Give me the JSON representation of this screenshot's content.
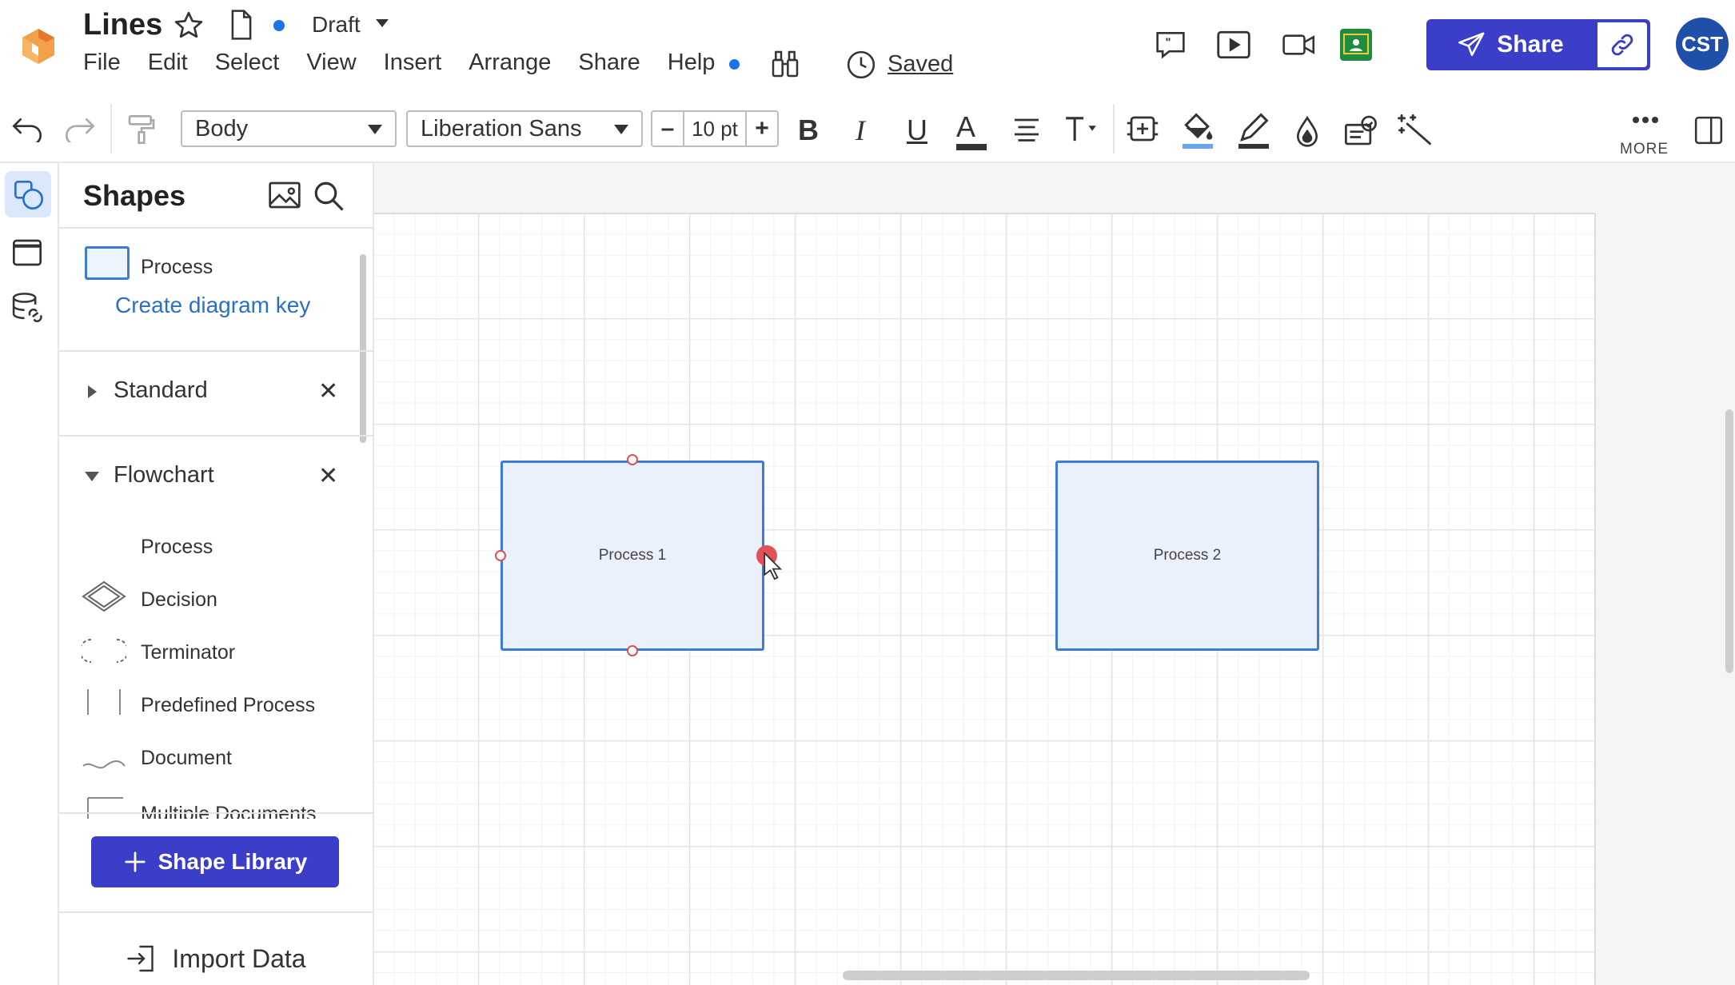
{
  "header": {
    "title": "Lines",
    "status": "Draft",
    "saved_label": "Saved",
    "menu": [
      "File",
      "Edit",
      "Select",
      "View",
      "Insert",
      "Arrange",
      "Share",
      "Help"
    ],
    "share_label": "Share",
    "avatar_initials": "CST"
  },
  "toolbar": {
    "style_value": "Body",
    "font_value": "Liberation Sans",
    "font_size": "10 pt",
    "decrease_label": "–",
    "increase_label": "+",
    "bold": "B",
    "italic": "I",
    "underline": "U",
    "text_color": "A",
    "more_label": "MORE"
  },
  "panel": {
    "title": "Shapes",
    "key_item_label": "Process",
    "create_key_link": "Create diagram key",
    "sections": [
      {
        "label": "Standard",
        "expanded": false
      },
      {
        "label": "Flowchart",
        "expanded": true
      }
    ],
    "flowchart_shapes": [
      "Process",
      "Decision",
      "Terminator",
      "Predefined Process",
      "Document",
      "Multiple Documents"
    ],
    "shape_library_button": "Shape Library",
    "import_data_button": "Import Data"
  },
  "canvas": {
    "shapes": [
      {
        "label": "Process 1",
        "selected_connection_point": "right"
      },
      {
        "label": "Process 2"
      }
    ]
  },
  "colors": {
    "accent": "#3b3ec9",
    "link": "#2a6fc9",
    "shape_border": "#3d7bd9",
    "shape_fill": "#eaf1fc",
    "handle": "#e05257",
    "avatar": "#1f4fa8"
  },
  "icons": [
    "logo-icon",
    "star-icon",
    "document-icon",
    "binoculars-icon",
    "clock-icon",
    "comment-icon",
    "present-icon",
    "video-icon",
    "classroom-icon",
    "send-icon",
    "link-icon",
    "undo-icon",
    "redo-icon",
    "format-painter-icon",
    "align-icon",
    "text-options-icon",
    "container-icon",
    "fill-icon",
    "line-color-icon",
    "opacity-icon",
    "conditional-format-icon",
    "magic-icon",
    "more-icon",
    "right-panel-icon",
    "shapes-icon",
    "pages-icon",
    "data-icon",
    "image-icon",
    "search-icon",
    "close-icon",
    "plus-icon",
    "import-icon"
  ]
}
